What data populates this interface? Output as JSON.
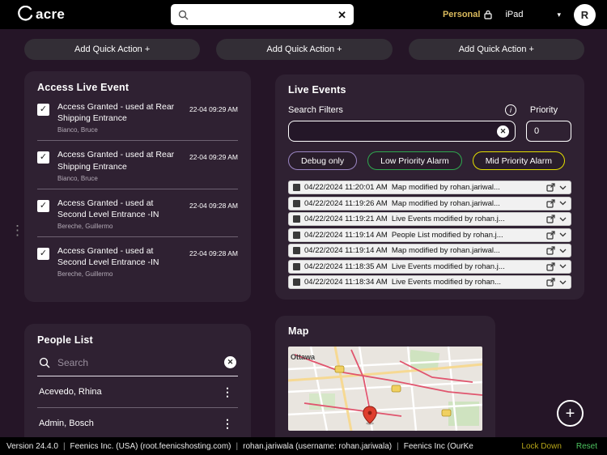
{
  "topbar": {
    "logo_text": "acre",
    "search_value": "",
    "personal_label": "Personal",
    "device_label": "iPad",
    "avatar_letter": "R"
  },
  "quick_actions": [
    {
      "label": "Add Quick Action +"
    },
    {
      "label": "Add Quick Action +"
    },
    {
      "label": "Add Quick Action +"
    }
  ],
  "access_live_event": {
    "title": "Access Live Event",
    "events": [
      {
        "title": "Access Granted - used at Rear Shipping Entrance",
        "person": "Bianco, Bruce",
        "time": "22-04 09:29 AM"
      },
      {
        "title": "Access Granted - used at Rear Shipping Entrance",
        "person": "Bianco, Bruce",
        "time": "22-04 09:29 AM"
      },
      {
        "title": "Access Granted - used at Second Level Entrance -IN",
        "person": "Bereche, Guillermo",
        "time": "22-04 09:28 AM"
      },
      {
        "title": "Access Granted - used at Second Level Entrance -IN",
        "person": "Bereche, Guillermo",
        "time": "22-04 09:28 AM"
      }
    ]
  },
  "live_events": {
    "title": "Live Events",
    "search_filters_label": "Search Filters",
    "search_value": "",
    "priority_label": "Priority",
    "priority_value": "0",
    "filters": [
      {
        "label": "Debug only",
        "border_color": "#9b86c4"
      },
      {
        "label": "Low Priority Alarm",
        "border_color": "#2fa84f"
      },
      {
        "label": "Mid Priority Alarm",
        "border_color": "#e3de00"
      }
    ],
    "rows": [
      {
        "timestamp": "04/22/2024 11:20:01 AM",
        "message": "Map modified by rohan.jariwal..."
      },
      {
        "timestamp": "04/22/2024 11:19:26 AM",
        "message": "Map modified by rohan.jariwal..."
      },
      {
        "timestamp": "04/22/2024 11:19:21 AM",
        "message": "Live Events modified by rohan.j..."
      },
      {
        "timestamp": "04/22/2024 11:19:14 AM",
        "message": "People List modified by rohan.j..."
      },
      {
        "timestamp": "04/22/2024 11:19:14 AM",
        "message": "Map modified by rohan.jariwal..."
      },
      {
        "timestamp": "04/22/2024 11:18:35 AM",
        "message": "Live Events modified by rohan.j..."
      },
      {
        "timestamp": "04/22/2024 11:18:34 AM",
        "message": "Live Events modified by rohan..."
      }
    ]
  },
  "people_list": {
    "title": "People List",
    "search_placeholder": "Search",
    "people": [
      {
        "name": "Acevedo, Rhina"
      },
      {
        "name": "Admin, Bosch"
      }
    ]
  },
  "map": {
    "title": "Map",
    "city_label": "Ottawa"
  },
  "footer": {
    "version": "Version 24.4.0",
    "separator": "|",
    "org1": "Feenics Inc. (USA) (root.feenicshosting.com)",
    "user": "rohan.jariwala (username: rohan.jariwala)",
    "org2": "Feenics Inc (OurKe",
    "lock_down_label": "Lock Down",
    "reset_label": "Reset"
  },
  "icons": {
    "check": "✓",
    "clear": "✕",
    "info": "i",
    "chevron_down": "▾",
    "kebab": "⋮",
    "plus": "+",
    "drag_dots": "⋮"
  },
  "colors": {
    "page_bg": "#251527",
    "panel_bg": "#2f2132",
    "accent_gold": "#d9b95c",
    "lockdown_yellow": "#b5a418",
    "reset_green": "#4cc35f",
    "filter_debug_border": "#9b86c4",
    "filter_low_border": "#2fa84f",
    "filter_mid_border": "#e3de00"
  }
}
